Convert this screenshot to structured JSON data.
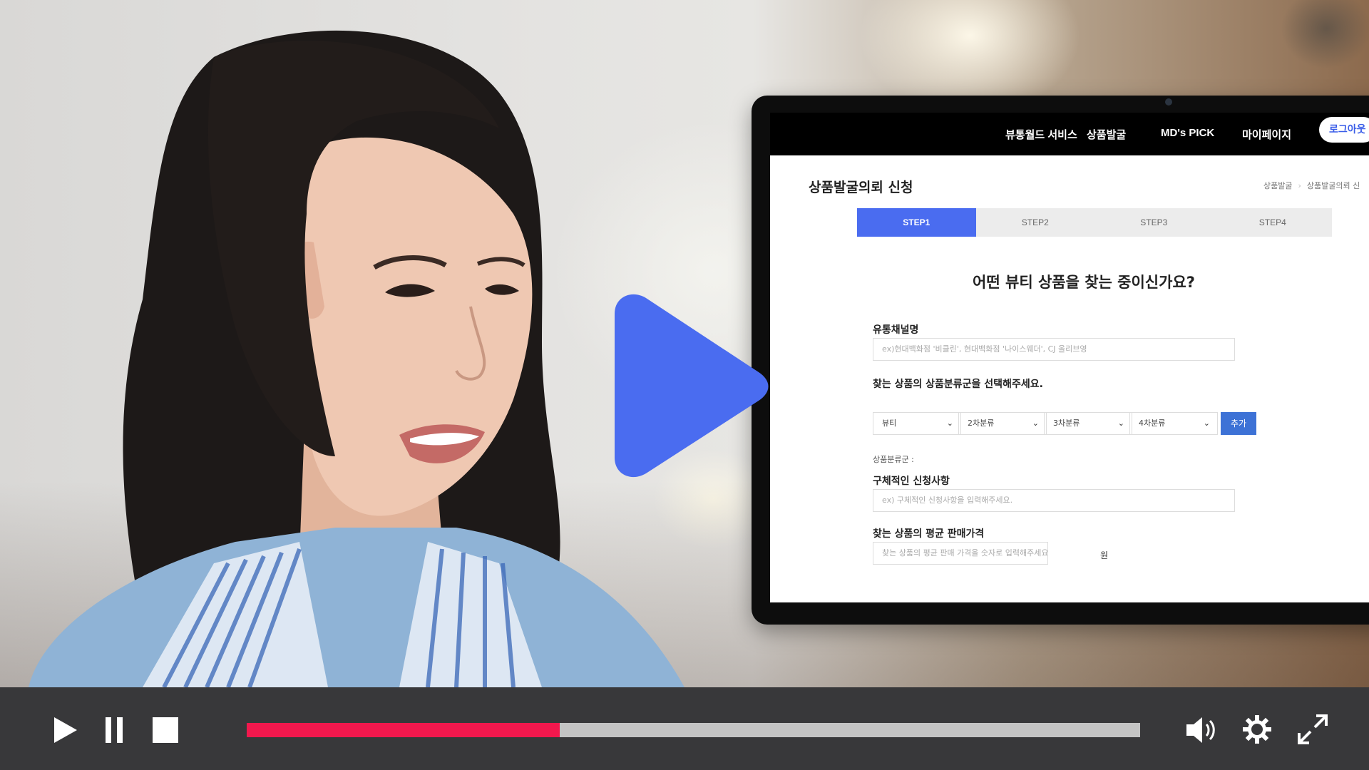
{
  "site": {
    "nav": [
      "뷰통월드 서비스",
      "상품발굴",
      "MD's PICK",
      "마이페이지"
    ],
    "logout": "로그아웃"
  },
  "page": {
    "title": "상품발굴의뢰 신청",
    "breadcrumb": [
      "상품발굴",
      "상품발굴의뢰 신"
    ]
  },
  "steps": [
    "STEP1",
    "STEP2",
    "STEP3",
    "STEP4"
  ],
  "active_step": "STEP1",
  "question": "어떤 뷰티 상품을 찾는 중이신가요?",
  "form": {
    "channel_label": "유통채널명",
    "channel_placeholder": "ex)현대백화점 '비클린', 현대백화점 '나이스웨더', CJ 올리브영",
    "category_label": "찾는 상품의 상품분류군을 선택해주세요.",
    "category_selects": [
      "뷰티",
      "2차분류",
      "3차분류",
      "4차분류"
    ],
    "add_button": "추가",
    "category_note": "상품분류군 :",
    "detail_label": "구체적인 신청사항",
    "detail_placeholder": "ex) 구체적인 신청사항을 입력해주세요.",
    "price_label": "찾는 상품의 평균 판매가격",
    "price_placeholder": "찾는 상품의 평균 판매 가격을 숫자로 입력해주세요.",
    "price_unit": "원"
  },
  "player": {
    "progress": 0.35,
    "icons": [
      "play-icon",
      "pause-icon",
      "stop-icon",
      "volume-icon",
      "settings-icon",
      "fullscreen-icon"
    ],
    "colors": {
      "progress_fill": "#f2184d",
      "track": "#c4c4c4",
      "bar": "#38383a",
      "big_play": "#4a6cf0"
    }
  }
}
